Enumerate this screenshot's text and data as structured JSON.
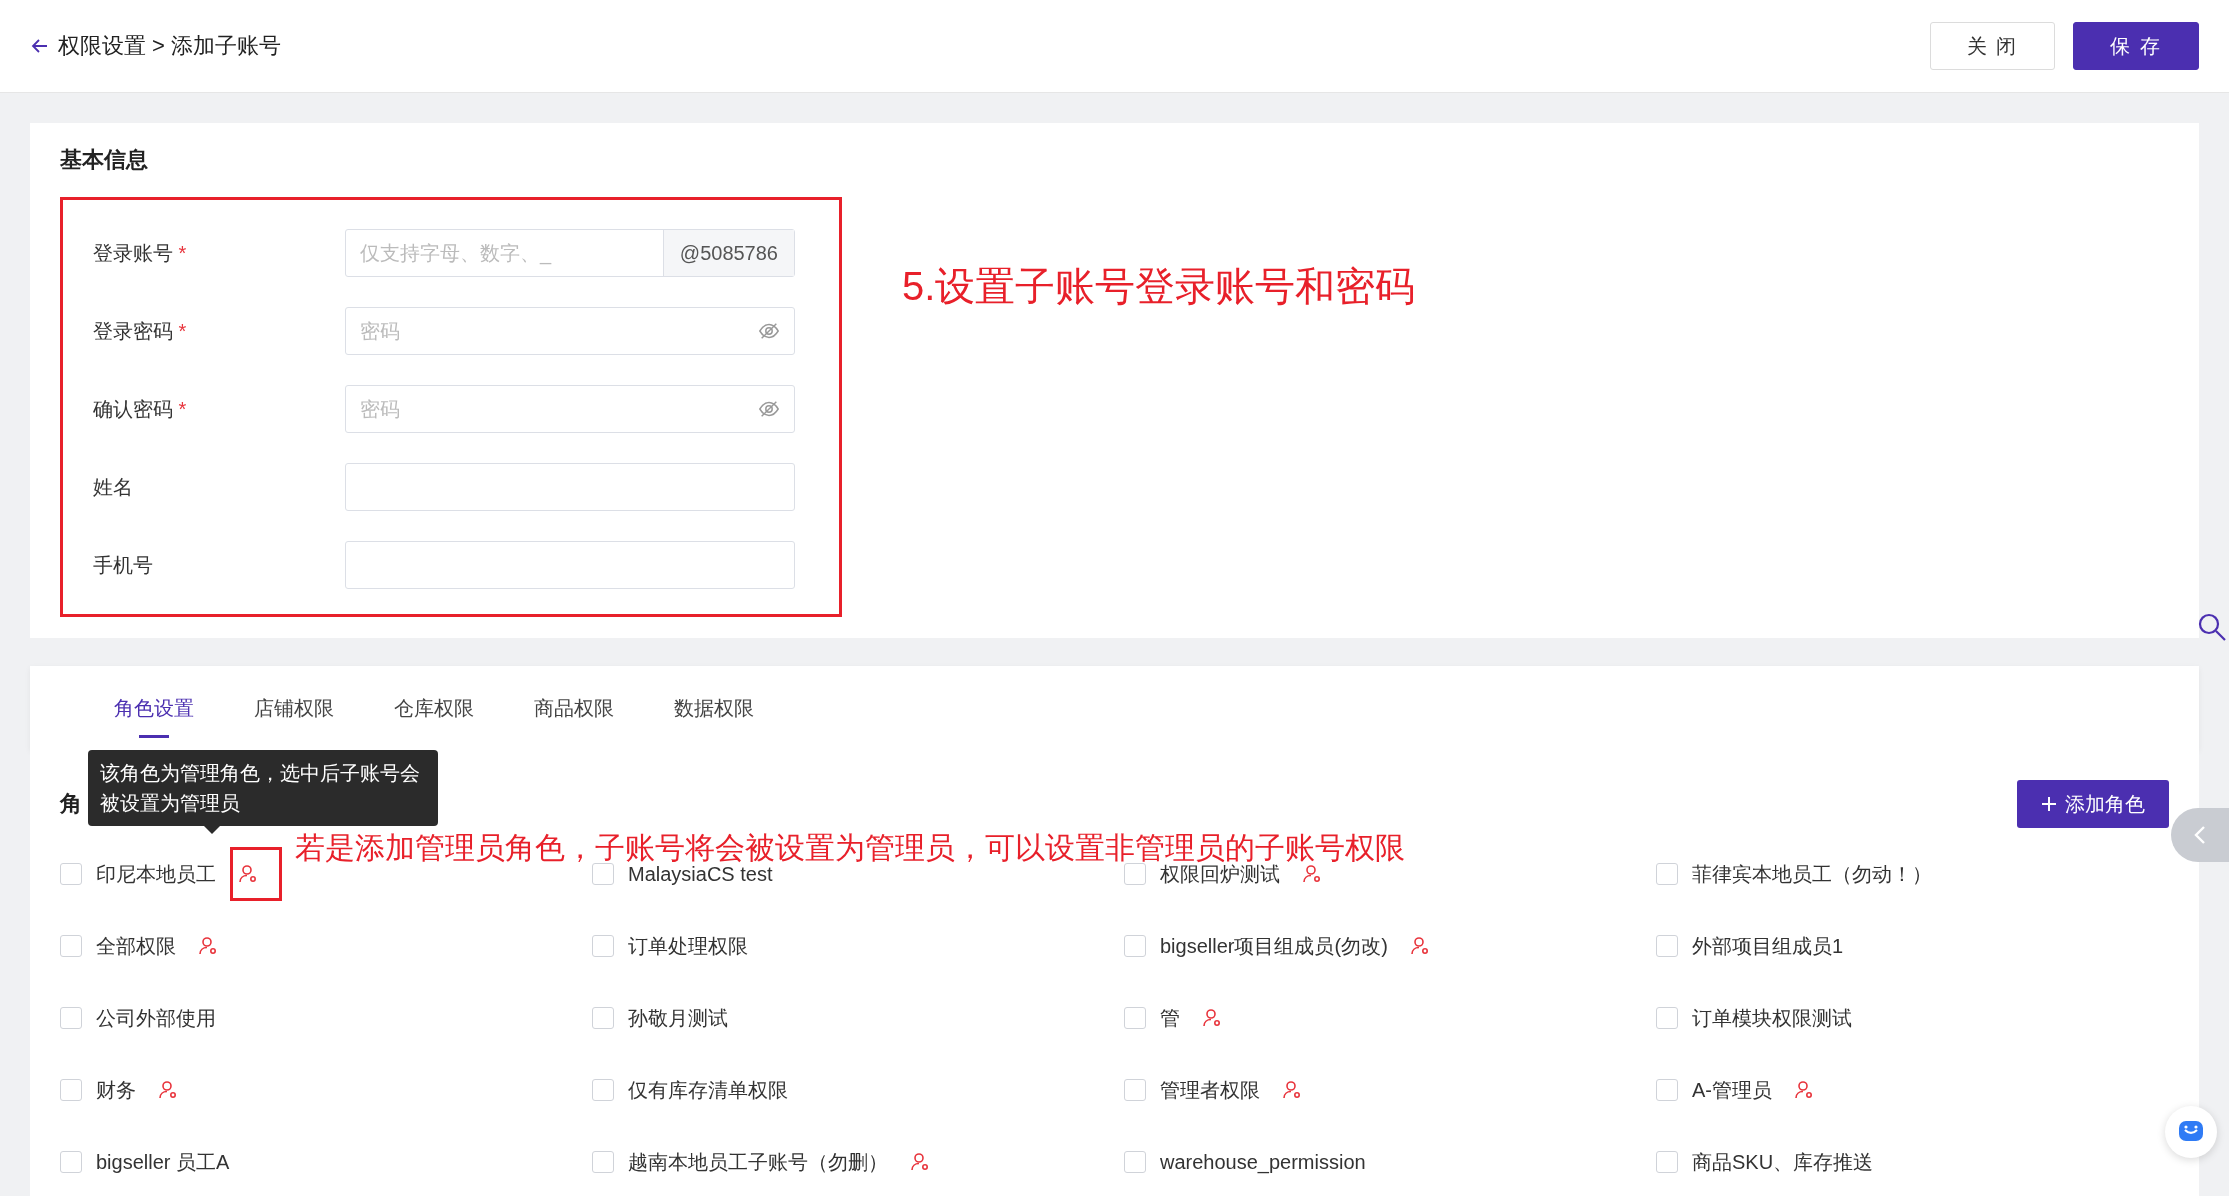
{
  "breadcrumb": "权限设置 > 添加子账号",
  "buttons": [
    {
      "label": "关 闭",
      "kind": "secondary"
    },
    {
      "label": "保 存",
      "kind": "primary"
    }
  ],
  "basic_info": {
    "title": "基本信息",
    "fields": [
      {
        "label": "登录账号",
        "required_mark": "*",
        "kind": "text",
        "placeholder": "仅支持字母、数字、_",
        "suffix": "@5085786"
      },
      {
        "label": "登录密码",
        "required_mark": "*",
        "kind": "password",
        "placeholder": "密码"
      },
      {
        "label": "确认密码",
        "required_mark": "*",
        "kind": "password",
        "placeholder": "密码"
      },
      {
        "label": "姓名",
        "kind": "text"
      },
      {
        "label": "手机号",
        "kind": "text"
      }
    ]
  },
  "annotation_1": "5.设置子账号登录账号和密码",
  "tabs": [
    {
      "label": "角色设置",
      "selected": true
    },
    {
      "label": "店铺权限",
      "selected": false
    },
    {
      "label": "仓库权限",
      "selected": false
    },
    {
      "label": "商品权限",
      "selected": false
    },
    {
      "label": "数据权限",
      "selected": false
    }
  ],
  "roles": {
    "heading": "角",
    "tooltip": "该角色为管理角色，选中后子账号会被设置为管理员",
    "add_button": "添加角色",
    "items": [
      {
        "label": "印尼本地员工",
        "checked": false,
        "admin": true
      },
      {
        "label": "MalaysiaCS test",
        "checked": false,
        "admin": false
      },
      {
        "label": "权限回炉测试",
        "checked": false,
        "admin": true
      },
      {
        "label": "菲律宾本地员工（勿动！）",
        "checked": false,
        "admin": false
      },
      {
        "label": "全部权限",
        "checked": false,
        "admin": true
      },
      {
        "label": "订单处理权限",
        "checked": false,
        "admin": false
      },
      {
        "label": "bigseller项目组成员(勿改)",
        "checked": false,
        "admin": true
      },
      {
        "label": "外部项目组成员1",
        "checked": false,
        "admin": false
      },
      {
        "label": "公司外部使用",
        "checked": false,
        "admin": false
      },
      {
        "label": "孙敬月测试",
        "checked": false,
        "admin": false
      },
      {
        "label": "管",
        "checked": false,
        "admin": true
      },
      {
        "label": "订单模块权限测试",
        "checked": false,
        "admin": false
      },
      {
        "label": "财务",
        "checked": false,
        "admin": true
      },
      {
        "label": "仅有库存清单权限",
        "checked": false,
        "admin": false
      },
      {
        "label": "管理者权限",
        "checked": false,
        "admin": true
      },
      {
        "label": "A-管理员",
        "checked": false,
        "admin": true
      },
      {
        "label": "bigseller 员工A",
        "checked": false,
        "admin": false
      },
      {
        "label": "越南本地员工子账号（勿删）",
        "checked": false,
        "admin": true
      },
      {
        "label": "warehouse_permission",
        "checked": false,
        "admin": false
      },
      {
        "label": "商品SKU、库存推送",
        "checked": false,
        "admin": false
      }
    ]
  },
  "annotation_2": "若是添加管理员角色，子账号将会被设置为管理员，可以设置非管理员的子账号权限"
}
